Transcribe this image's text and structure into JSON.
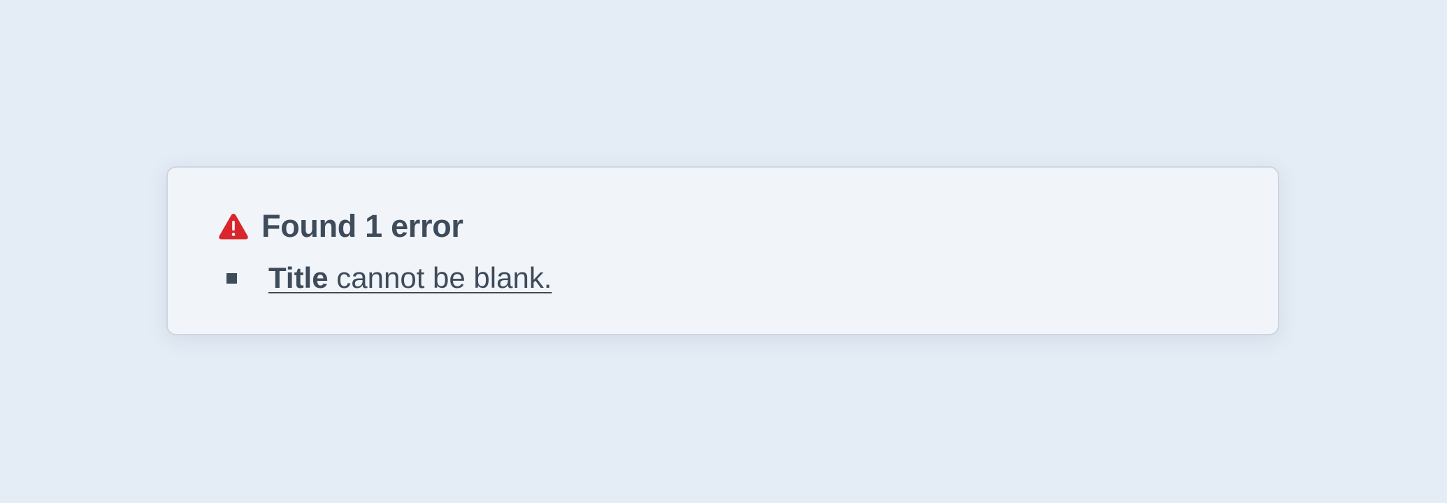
{
  "colors": {
    "background": "#e4ecf5",
    "panel": "#f1f5fa",
    "panel_border": "#cdd6e0",
    "text": "#3e4b5a",
    "warning": "#d9262c"
  },
  "error_summary": {
    "icon": "warning-triangle-icon",
    "heading": "Found 1 error",
    "errors": [
      {
        "field": "Title",
        "message": " cannot be blank."
      }
    ]
  }
}
